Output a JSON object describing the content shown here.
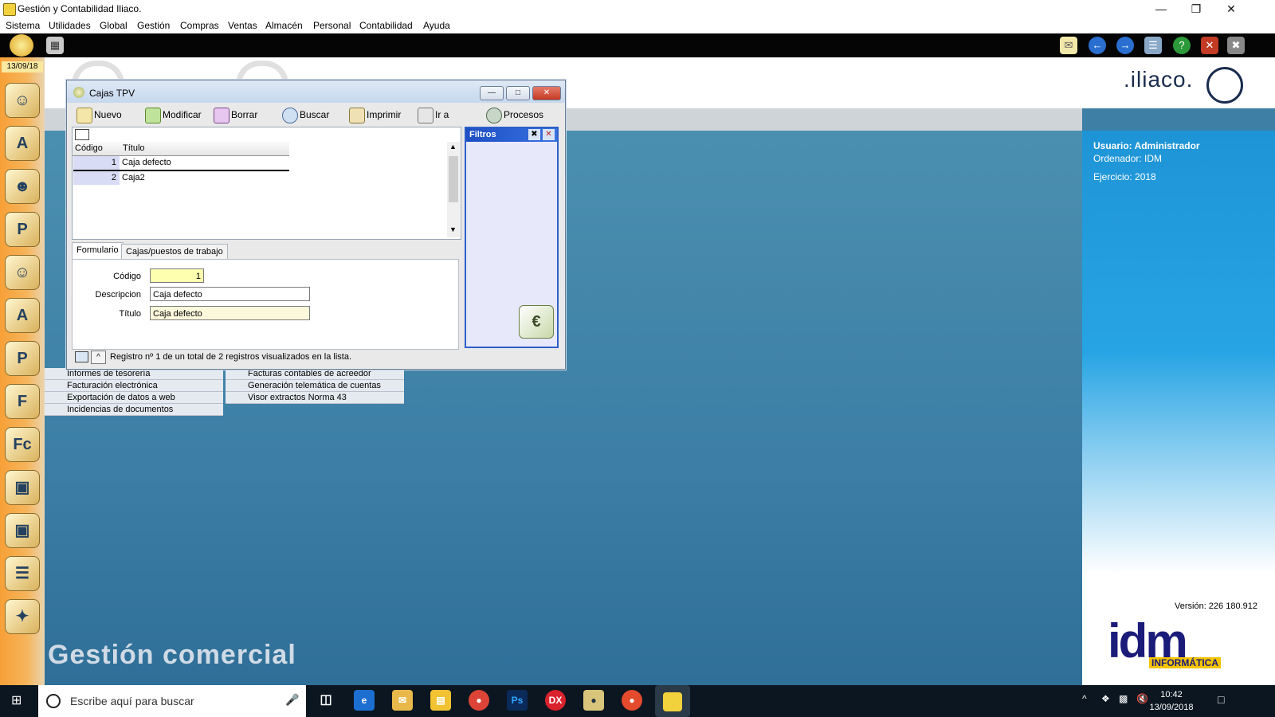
{
  "window": {
    "title": "Gestión y Contabilidad Iliaco."
  },
  "menu": [
    "Sistema",
    "Utilidades",
    "Global",
    "Gestión",
    "Compras",
    "Ventas",
    "Almacén",
    "Personal",
    "Contabilidad",
    "Ayuda"
  ],
  "sidebar": {
    "date": "13/09/18"
  },
  "background": {
    "col1": [
      "Informes de tesorería",
      "Facturación electrónica",
      "Exportación de datos a web",
      "Incidencias de documentos"
    ],
    "col2": [
      "Facturas contables de acreedor",
      "Generación telemática de cuentas",
      "Visor extractos Norma 43"
    ],
    "section_title": "Gestión comercial"
  },
  "brand": {
    "name": ".iliaco.",
    "logo": "idm",
    "logo_sub": "INFORMÁTICA"
  },
  "info": {
    "usuario": "Usuario: Administrador",
    "ordenador": "Ordenador: IDM",
    "ejercicio": "Ejercicio: 2018",
    "version": "Versión: 226 180.912"
  },
  "dialog": {
    "title": "Cajas TPV",
    "toolbar": {
      "nuevo": "Nuevo",
      "modificar": "Modificar",
      "borrar": "Borrar",
      "buscar": "Buscar",
      "imprimir": "Imprimir",
      "ira": "Ir a",
      "procesos": "Procesos"
    },
    "list": {
      "columns": [
        "Código",
        "Título"
      ],
      "rows": [
        {
          "codigo": "1",
          "titulo": "Caja defecto"
        },
        {
          "codigo": "2",
          "titulo": "Caja2"
        }
      ]
    },
    "filtros": {
      "title": "Filtros"
    },
    "tabs": [
      "Formulario",
      "Cajas/puestos de trabajo"
    ],
    "form": {
      "codigo_label": "Código",
      "codigo_value": "1",
      "descripcion_label": "Descripcion",
      "descripcion_value": "Caja defecto",
      "titulo_label": "Título",
      "titulo_value": "Caja defecto"
    },
    "status": "Registro nº 1 de un total de 2 registros visualizados en la lista."
  },
  "taskbar": {
    "search_placeholder": "Escribe aquí para buscar",
    "time": "10:42",
    "date": "13/09/2018"
  }
}
